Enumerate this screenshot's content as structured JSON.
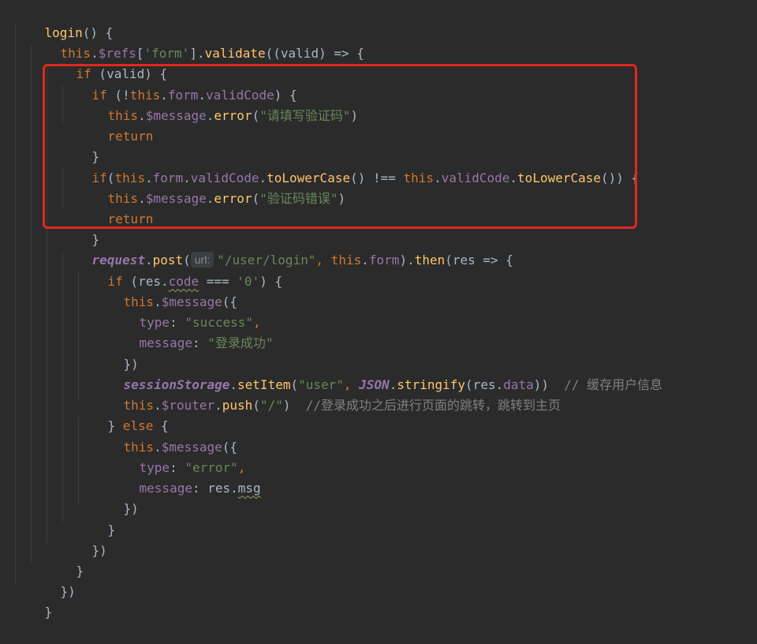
{
  "code": {
    "l1": [
      "login",
      "() {"
    ],
    "l2": [
      "this",
      ".",
      "$refs",
      "[",
      "'form'",
      "].",
      "validate",
      "((valid) => {"
    ],
    "l3": [
      "if",
      " (valid) {"
    ],
    "l4": [
      "if",
      " (!",
      "this",
      ".",
      "form",
      ".",
      "validCode",
      ") {"
    ],
    "l5": [
      "this",
      ".",
      "$message",
      ".",
      "error",
      "(",
      "\"请填写验证码\"",
      ")"
    ],
    "l6": [
      "return"
    ],
    "l7": [
      "}"
    ],
    "l8": [
      "if",
      "(",
      "this",
      ".",
      "form",
      ".",
      "validCode",
      ".",
      "toLowerCase",
      "() !== ",
      "this",
      ".",
      "validCode",
      ".",
      "toLowerCase",
      "()) {"
    ],
    "l9": [
      "this",
      ".",
      "$message",
      ".",
      "error",
      "(",
      "\"验证码错误\"",
      ")"
    ],
    "l10": [
      "return"
    ],
    "l11": [
      "}"
    ],
    "l12": [
      "request",
      ".",
      "post",
      "(",
      "url:",
      "\"/user/login\"",
      ", ",
      "this",
      ".",
      "form",
      ").",
      "then",
      "(res => {"
    ],
    "l13": [
      "if",
      " (res.",
      "code",
      " === ",
      "'0'",
      ") {"
    ],
    "l14": [
      "this",
      ".",
      "$message",
      "({"
    ],
    "l15": [
      "type",
      ": ",
      "\"success\"",
      ","
    ],
    "l16": [
      "message",
      ": ",
      "\"登录成功\""
    ],
    "l17": [
      "})"
    ],
    "l18": [
      "sessionStorage",
      ".",
      "setItem",
      "(",
      "\"user\"",
      ", ",
      "JSON",
      ".",
      "stringify",
      "(res.",
      "data",
      "))",
      "  // 缓存用户信息"
    ],
    "l19": [
      "this",
      ".",
      "$router",
      ".",
      "push",
      "(",
      "\"/\"",
      ")",
      "  //登录成功之后进行页面的跳转，跳转到主页"
    ],
    "l20": [
      "}",
      " else ",
      "{"
    ],
    "l21": [
      "this",
      ".",
      "$message",
      "({"
    ],
    "l22": [
      "type",
      ": ",
      "\"error\"",
      ","
    ],
    "l23": [
      "message",
      ": res.",
      "msg"
    ],
    "l24": [
      "})"
    ],
    "l25": [
      "}"
    ],
    "l26": [
      "})"
    ],
    "l27": [
      "}"
    ],
    "l28": [
      "})"
    ],
    "l29": [
      "}"
    ]
  },
  "colors": {
    "background": "#2b2b2b",
    "keyword": "#cc7832",
    "property": "#9876aa",
    "function": "#ffc66d",
    "string": "#6a8759",
    "comment": "#808080",
    "highlight_box": "#e0281f"
  }
}
